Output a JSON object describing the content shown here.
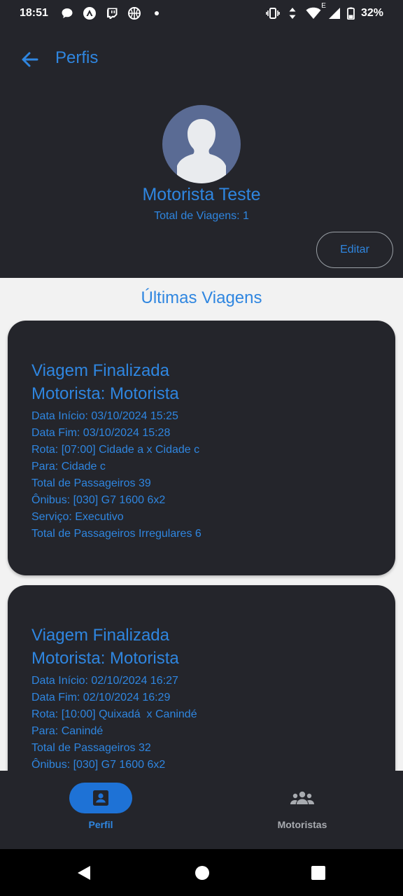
{
  "status_bar": {
    "time": "18:51",
    "battery": "32%",
    "network_letter": "E",
    "left_icons": [
      "chat-bubble-icon",
      "vpn-icon",
      "twitch-icon",
      "basketball-icon",
      "dot-icon"
    ],
    "right_icons": [
      "vibrate-icon",
      "data-arrows-icon",
      "wifi-icon",
      "signal-icon",
      "battery-icon"
    ]
  },
  "header": {
    "title": "Perfis",
    "back_icon": "arrow-left-icon"
  },
  "profile": {
    "name": "Motorista Teste",
    "total_trips": "Total de Viagens: 1",
    "edit_label": "Editar",
    "avatar_icon": "person-silhouette-icon"
  },
  "section": {
    "title": "Últimas Viagens"
  },
  "trips": [
    {
      "status": "Viagem Finalizada",
      "driver": "Motorista: Motorista",
      "start": "Data Início: 03/10/2024 15:25",
      "end": "Data Fim: 03/10/2024 15:28",
      "route": "Rota: [07:00] Cidade a x Cidade c",
      "destination": "Para: Cidade c",
      "passengers": "Total de Passageiros 39",
      "bus": "Ônibus: [030] G7 1600 6x2",
      "service": "Serviço: Executivo",
      "irregular": "Total de Passageiros Irregulares 6"
    },
    {
      "status": "Viagem Finalizada",
      "driver": "Motorista: Motorista",
      "start": "Data Início: 02/10/2024 16:27",
      "end": "Data Fim: 02/10/2024 16:29",
      "route": "Rota: [10:00] Quixadá  x Canindé",
      "destination": "Para: Canindé",
      "passengers": "Total de Passageiros 32",
      "bus": "Ônibus: [030] G7 1600 6x2"
    }
  ],
  "bottom_nav": {
    "items": [
      {
        "label": "Perfil",
        "icon": "profile-card-icon",
        "active": true
      },
      {
        "label": "Motoristas",
        "icon": "group-icon",
        "active": false
      }
    ]
  },
  "colors": {
    "accent": "#2f86e0",
    "dark_surface": "#24252b",
    "light_background": "#f2f2f2",
    "active_pill": "#1e72d6"
  }
}
